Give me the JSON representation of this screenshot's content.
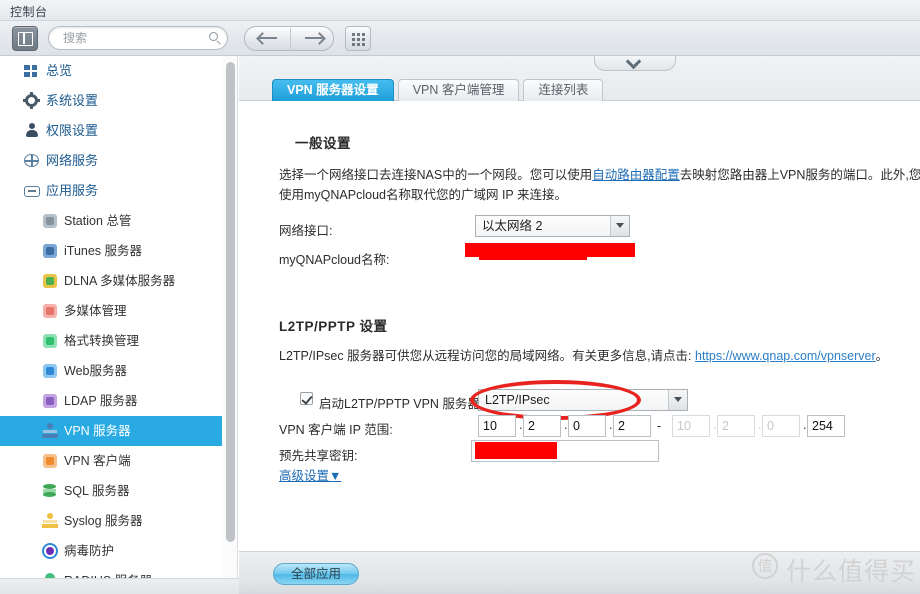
{
  "window": {
    "title": "控制台"
  },
  "toolbar": {
    "search_placeholder": "搜索",
    "search_value": "",
    "panel_toggle_name": "面板",
    "back_name": "后退",
    "forward_name": "前进",
    "apps_name": "应用程序"
  },
  "sidebar": {
    "items": [
      {
        "label": "总览",
        "icon": "grid-icon",
        "level": 0,
        "active": false
      },
      {
        "label": "系统设置",
        "icon": "gear-icon",
        "level": 0,
        "active": false
      },
      {
        "label": "权限设置",
        "icon": "user-icon",
        "level": 0,
        "active": false
      },
      {
        "label": "网络服务",
        "icon": "globe-icon",
        "level": 0,
        "active": false
      },
      {
        "label": "应用服务",
        "icon": "box-icon",
        "level": 0,
        "active": false
      },
      {
        "label": "Station 总管",
        "icon": "station-icon",
        "level": 1,
        "active": false
      },
      {
        "label": "iTunes 服务器",
        "icon": "itunes-icon",
        "level": 1,
        "active": false
      },
      {
        "label": "DLNA 多媒体服务器",
        "icon": "dlna-icon",
        "level": 1,
        "active": false
      },
      {
        "label": "多媒体管理",
        "icon": "media-icon",
        "level": 1,
        "active": false
      },
      {
        "label": "格式转换管理",
        "icon": "transcode-icon",
        "level": 1,
        "active": false
      },
      {
        "label": "Web服务器",
        "icon": "web-icon",
        "level": 1,
        "active": false
      },
      {
        "label": "LDAP 服务器",
        "icon": "ldap-icon",
        "level": 1,
        "active": false
      },
      {
        "label": "VPN 服务器",
        "icon": "vpn-server-icon",
        "level": 1,
        "active": true
      },
      {
        "label": "VPN 客户端",
        "icon": "vpn-client-icon",
        "level": 1,
        "active": false
      },
      {
        "label": "SQL 服务器",
        "icon": "sql-icon",
        "level": 1,
        "active": false
      },
      {
        "label": "Syslog 服务器",
        "icon": "syslog-icon",
        "level": 1,
        "active": false
      },
      {
        "label": "病毒防护",
        "icon": "antivirus-icon",
        "level": 1,
        "active": false
      },
      {
        "label": "RADIUS 服务器",
        "icon": "radius-icon",
        "level": 1,
        "active": false
      }
    ]
  },
  "main": {
    "tabs": [
      {
        "label": "VPN 服务器设置",
        "active": true
      },
      {
        "label": "VPN 客户端管理",
        "active": false
      },
      {
        "label": "连接列表",
        "active": false
      }
    ],
    "general": {
      "title": "一般设置",
      "desc_part1": "选择一个网络接口去连接NAS中的一个网段。您可以使用",
      "desc_link": "自动路由器配置",
      "desc_part2": "去映射您路由器上VPN服务的端口。此外,您",
      "desc_line2": "使用myQNAPcloud名称取代您的广域网 IP 来连接。",
      "iface_label": "网络接口:",
      "iface_value": "以太网络 2",
      "mycloud_label": "myQNAPcloud名称:",
      "mycloud_value": ""
    },
    "l2tp": {
      "title": "L2TP/PPTP 设置",
      "desc": "L2TP/IPsec 服务器可供您从远程访问您的局域网络。有关更多信息,请点击:",
      "desc_link": "https://www.qnap.com/vpnserver",
      "desc_tail": "。",
      "enable_label": "启动L2TP/PPTP VPN 服务器",
      "enable_checked": true,
      "protocol_value": "L2TP/IPsec",
      "iprange_label": "VPN 客户端 IP 范围:",
      "ip_start": [
        "10",
        "2",
        "0",
        "2"
      ],
      "ip_end": [
        "10",
        "2",
        "0",
        "254"
      ],
      "range_dash": "-",
      "psk_label": "预先共享密钥:",
      "psk_value": "",
      "advanced_label": "高级设置",
      "advanced_caret": "▼"
    },
    "footer": {
      "apply_label": "全部应用"
    }
  },
  "watermark": {
    "mark": "值",
    "text": "什么值得买"
  },
  "colors": {
    "accent": "#29aae3",
    "tab_active": "#1d9fd8",
    "link": "#1b6bb5",
    "annotation_red": "#e8231f",
    "redaction": "#ff0000"
  }
}
